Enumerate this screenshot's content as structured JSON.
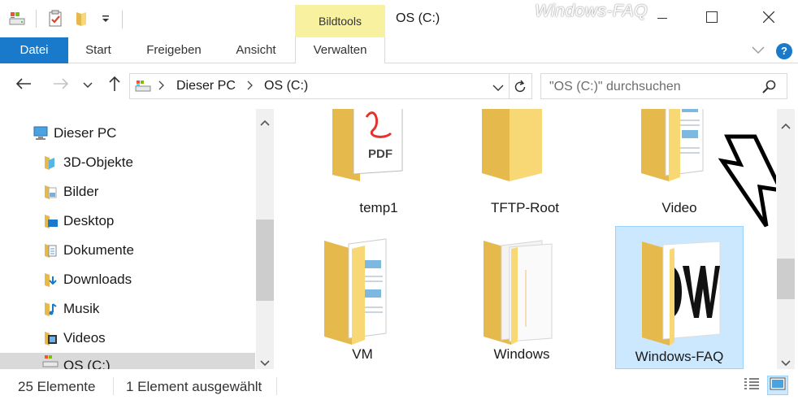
{
  "titlebar": {
    "contextual_tab": "Bildtools",
    "window_title": "OS (C:)",
    "watermark": "Windows-FAQ",
    "minimize_icon": "minimize-icon",
    "maximize_icon": "maximize-icon",
    "close_icon": "close-icon"
  },
  "quick_access": {
    "icons": [
      "drive-icon",
      "properties-check-icon",
      "new-folder-icon",
      "customize-dropdown-icon"
    ]
  },
  "ribbon": {
    "tabs": [
      {
        "label": "Datei"
      },
      {
        "label": "Start"
      },
      {
        "label": "Freigeben"
      },
      {
        "label": "Ansicht"
      },
      {
        "label": "Verwalten"
      }
    ],
    "help_label": "?"
  },
  "address": {
    "crumbs": [
      "Dieser PC",
      "OS (C:)"
    ]
  },
  "search": {
    "placeholder": "\"OS (C:)\" durchsuchen"
  },
  "nav_pane": {
    "items": [
      {
        "label": "Dieser PC",
        "icon": "computer-icon"
      },
      {
        "label": "3D-Objekte",
        "icon": "3d-objects-icon"
      },
      {
        "label": "Bilder",
        "icon": "pictures-icon"
      },
      {
        "label": "Desktop",
        "icon": "desktop-icon"
      },
      {
        "label": "Dokumente",
        "icon": "documents-icon"
      },
      {
        "label": "Downloads",
        "icon": "downloads-icon"
      },
      {
        "label": "Musik",
        "icon": "music-icon"
      },
      {
        "label": "Videos",
        "icon": "videos-icon"
      },
      {
        "label": "OS (C:)",
        "icon": "drive-icon"
      }
    ]
  },
  "content": {
    "items": [
      {
        "label": "temp1",
        "icon": "folder-pdf-icon"
      },
      {
        "label": "TFTP-Root",
        "icon": "folder-icon"
      },
      {
        "label": "Video",
        "icon": "folder-documents-icon"
      },
      {
        "label": "VM",
        "icon": "folder-documents-icon"
      },
      {
        "label": "Windows",
        "icon": "folder-white-pages-icon"
      },
      {
        "label": "Windows-FAQ",
        "icon": "folder-dw-icon"
      }
    ]
  },
  "status": {
    "count": "25 Elemente",
    "selection": "1 Element ausgewählt"
  },
  "colors": {
    "accent": "#1979ca",
    "contextual_tab": "#f7f1a0",
    "selection": "#cce8ff",
    "folder": "#f8d775"
  }
}
